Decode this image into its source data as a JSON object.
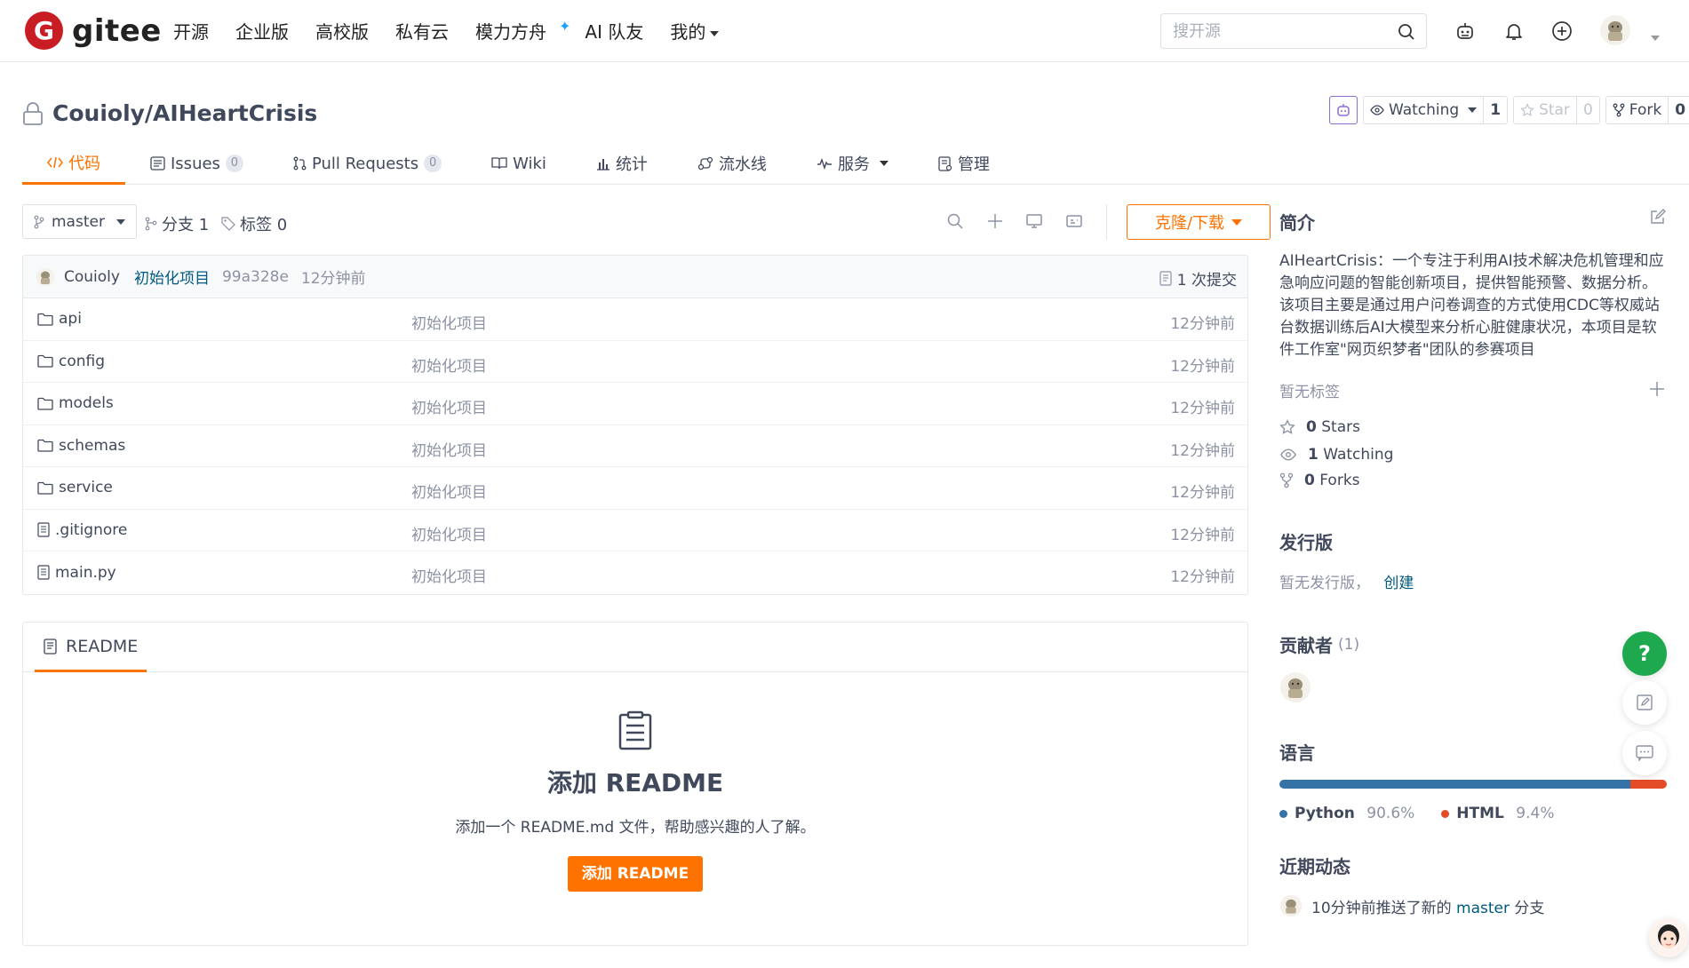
{
  "nav": {
    "logo_text": "gitee",
    "logo_mark": "G",
    "items": [
      "开源",
      "企业版",
      "高校版",
      "私有云",
      "模力方舟",
      "AI 队友",
      "我的"
    ],
    "search_placeholder": "搜开源"
  },
  "repo": {
    "title": "Couioly/AIHeartCrisis",
    "watching_label": "Watching",
    "watching_count": "1",
    "star_label": "Star",
    "star_count": "0",
    "fork_label": "Fork",
    "fork_count": "0"
  },
  "tabs": [
    {
      "label": "代码",
      "count": null
    },
    {
      "label": "Issues",
      "count": "0"
    },
    {
      "label": "Pull Requests",
      "count": "0"
    },
    {
      "label": "Wiki",
      "count": null
    },
    {
      "label": "统计",
      "count": null
    },
    {
      "label": "流水线",
      "count": null
    },
    {
      "label": "服务",
      "count": null
    },
    {
      "label": "管理",
      "count": null
    }
  ],
  "branchbar": {
    "branch": "master",
    "branches_label": "分支 1",
    "tags_label": "标签 0",
    "clone_label": "克隆/下载"
  },
  "commit": {
    "author": "Couioly",
    "message": "初始化项目",
    "sha": "99a328e",
    "time": "12分钟前",
    "commits_label": "1 次提交"
  },
  "files": [
    {
      "name": "api",
      "type": "folder",
      "message": "初始化项目",
      "time": "12分钟前"
    },
    {
      "name": "config",
      "type": "folder",
      "message": "初始化项目",
      "time": "12分钟前"
    },
    {
      "name": "models",
      "type": "folder",
      "message": "初始化项目",
      "time": "12分钟前"
    },
    {
      "name": "schemas",
      "type": "folder",
      "message": "初始化项目",
      "time": "12分钟前"
    },
    {
      "name": "service",
      "type": "folder",
      "message": "初始化项目",
      "time": "12分钟前"
    },
    {
      "name": ".gitignore",
      "type": "file",
      "message": "初始化项目",
      "time": "12分钟前"
    },
    {
      "name": "main.py",
      "type": "file",
      "message": "初始化项目",
      "time": "12分钟前"
    }
  ],
  "readme": {
    "tab_label": "README",
    "heading": "添加 README",
    "text": "添加一个 README.md 文件，帮助感兴趣的人了解。",
    "button": "添加 README"
  },
  "sidebar": {
    "intro_title": "简介",
    "description": "AIHeartCrisis：一个专注于利用AI技术解决危机管理和应急响应问题的智能创新项目，提供智能预警、数据分析。该项目主要是通过用户问卷调查的方式使用CDC等权威站台数据训练后AI大模型来分析心脏健康状况，本项目是软件工作室\"网页织梦者\"团队的参赛项目",
    "no_tags": "暂无标签",
    "stars_num": "0",
    "stars_label": "Stars",
    "watching_num": "1",
    "watching_label": "Watching",
    "forks_num": "0",
    "forks_label": "Forks",
    "release_title": "发行版",
    "release_text": "暂无发行版，",
    "release_link": "创建",
    "contributors_title": "贡献者",
    "contributors_count": "(1)",
    "language_title": "语言",
    "languages": [
      {
        "name": "Python",
        "percent": "90.6%",
        "value": 90.6,
        "color": "#3572A5"
      },
      {
        "name": "HTML",
        "percent": "9.4%",
        "value": 9.4,
        "color": "#e34c26"
      }
    ],
    "activity_title": "近期动态",
    "activity_text": "10分钟前推送了新的",
    "activity_branch": "master",
    "activity_suffix": "分支"
  },
  "floating": {
    "help": "?"
  },
  "colors": {
    "accent": "#fe7300",
    "brand": "#c71d23",
    "link": "#005980",
    "help": "#1ea94e"
  }
}
